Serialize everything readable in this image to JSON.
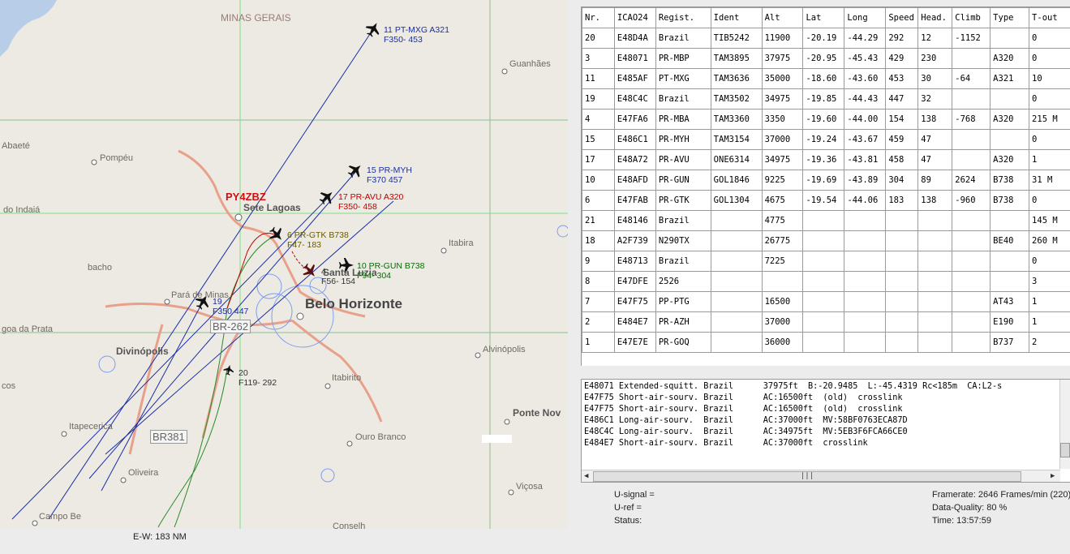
{
  "map": {
    "region_label": "MINAS GERAIS",
    "station_label": "PY4ZBZ",
    "ew_scale": "E-W: 183 NM",
    "cities": {
      "guanhaes": "Guanhães",
      "abaete": "Abaeté",
      "pompeu": "Pompéu",
      "do_indaia": "do Indaiá",
      "sete_lagoas": "Sete Lagoas",
      "itabira": "Itabira",
      "bacho": "bacho",
      "santa_luzia": "Santa Luzia",
      "para_de_minas": "Pará de Minas",
      "belo_horizonte": "Belo Horizonte",
      "lagoa_da_prata": "goa da Prata",
      "divinopolis": "Divinópolis",
      "alvinopolis": "Alvinópolis",
      "itabirito": "Itabirito",
      "cos": "cos",
      "ponte_nova": "Ponte Nov",
      "itapecerica": "Itapecerica",
      "ouro_branco": "Ouro Branco",
      "oliveira": "Oliveira",
      "vicosa": "Viçosa",
      "campo_belo": "Campo Be",
      "conselheiro": "Conselh"
    },
    "roads": {
      "br262": "BR-262",
      "br381": "BR381"
    },
    "aircraft": [
      {
        "line1": "11  PT-MXG  A321",
        "line2": "F350-  453",
        "color": "#1a2ea8"
      },
      {
        "line1": "15  PR-MYH",
        "line2": "F370   457",
        "color": "#1a2ea8"
      },
      {
        "line1": "17  PR-AVU  A320",
        "line2": "F350-  458",
        "color": "#c00000"
      },
      {
        "line1": "6  PR-GTK  B738",
        "line2": "F47-  183",
        "color": "#6b5a00"
      },
      {
        "line1": "10  PR-GUN  B738",
        "line2": "F94-  304",
        "color": "#0a6a0a"
      },
      {
        "line1": "4",
        "line2": "F56-  154",
        "color": "#333333"
      },
      {
        "line1": "19",
        "line2": "F350   447",
        "color": "#1a2ea8"
      },
      {
        "line1": "20",
        "line2": "F119-  292",
        "color": "#333333"
      }
    ]
  },
  "table": {
    "columns": [
      "Nr.",
      "ICAO24",
      "Regist.",
      "Ident",
      "Alt",
      "Lat",
      "Long",
      "Speed",
      "Head.",
      "Climb",
      "Type",
      "T-out"
    ],
    "rows": [
      [
        "20",
        "E48D4A",
        "Brazil",
        "TIB5242",
        "11900",
        "-20.19",
        "-44.29",
        "292",
        "12",
        "-1152",
        "",
        "0"
      ],
      [
        "3",
        "E48071",
        "PR-MBP",
        "TAM3895",
        "37975",
        "-20.95",
        "-45.43",
        "429",
        "230",
        "",
        "A320",
        "0"
      ],
      [
        "11",
        "E485AF",
        "PT-MXG",
        "TAM3636",
        "35000",
        "-18.60",
        "-43.60",
        "453",
        "30",
        "-64",
        "A321",
        "10"
      ],
      [
        "19",
        "E48C4C",
        "Brazil",
        "TAM3502",
        "34975",
        "-19.85",
        "-44.43",
        "447",
        "32",
        "",
        "",
        "0"
      ],
      [
        "4",
        "E47FA6",
        "PR-MBA",
        "TAM3360",
        "3350",
        "-19.60",
        "-44.00",
        "154",
        "138",
        "-768",
        "A320",
        "215 M"
      ],
      [
        "15",
        "E486C1",
        "PR-MYH",
        "TAM3154",
        "37000",
        "-19.24",
        "-43.67",
        "459",
        "47",
        "",
        "",
        "0"
      ],
      [
        "17",
        "E48A72",
        "PR-AVU",
        "ONE6314",
        "34975",
        "-19.36",
        "-43.81",
        "458",
        "47",
        "",
        "A320",
        "1"
      ],
      [
        "10",
        "E48AFD",
        "PR-GUN",
        "GOL1846",
        "9225",
        "-19.69",
        "-43.89",
        "304",
        "89",
        "2624",
        "B738",
        "31 M"
      ],
      [
        "6",
        "E47FAB",
        "PR-GTK",
        "GOL1304",
        "4675",
        "-19.54",
        "-44.06",
        "183",
        "138",
        "-960",
        "B738",
        "0"
      ],
      [
        "21",
        "E48146",
        "Brazil",
        "",
        "4775",
        "",
        "",
        "",
        "",
        "",
        "",
        "145 M"
      ],
      [
        "18",
        "A2F739",
        "N290TX",
        "",
        "26775",
        "",
        "",
        "",
        "",
        "",
        "BE40",
        "260 M"
      ],
      [
        "9",
        "E48713",
        "Brazil",
        "",
        "7225",
        "",
        "",
        "",
        "",
        "",
        "",
        "0"
      ],
      [
        "8",
        "E47DFE",
        "2526",
        "",
        "",
        "",
        "",
        "",
        "",
        "",
        "",
        "3"
      ],
      [
        "7",
        "E47F75",
        "PP-PTG",
        "",
        "16500",
        "",
        "",
        "",
        "",
        "",
        "AT43",
        "1"
      ],
      [
        "2",
        "E484E7",
        "PR-AZH",
        "",
        "37000",
        "",
        "",
        "",
        "",
        "",
        "E190",
        "1"
      ],
      [
        "1",
        "E47E7E",
        "PR-GOQ",
        "",
        "36000",
        "",
        "",
        "",
        "",
        "",
        "B737",
        "2"
      ]
    ]
  },
  "log": {
    "lines": [
      "E48071 Extended-squitt. Brazil      37975ft  B:-20.9485  L:-45.4319 Rc<185m  CA:L2-s",
      "E47F75 Short-air-sourv. Brazil      AC:16500ft  (old)  crosslink",
      "E47F75 Short-air-sourv. Brazil      AC:16500ft  (old)  crosslink",
      "E486C1 Long-air-sourv.  Brazil      AC:37000ft  MV:58BF0763ECA87D",
      "E48C4C Long-air-sourv.  Brazil      AC:34975ft  MV:5EB3F6FCA66CE0",
      "E484E7 Short-air-sourv. Brazil      AC:37000ft  crosslink"
    ],
    "hscroll_grip": "|||"
  },
  "status": {
    "u_signal": "U-signal =",
    "u_ref": "U-ref =",
    "status": "Status:",
    "framerate": "Framerate:  2646 Frames/min (220)",
    "data_quality": "Data-Quality:  80 %",
    "time": "Time: 13:57:59"
  }
}
